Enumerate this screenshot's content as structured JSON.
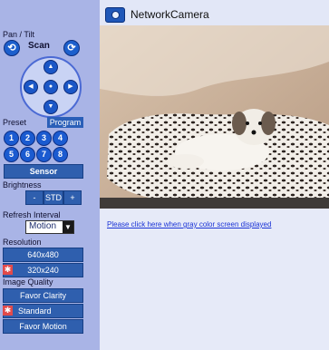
{
  "header": {
    "title": "NetworkCamera"
  },
  "sidebar": {
    "pan_tilt_label": "Pan / Tilt",
    "scan_label": "Scan",
    "preset_label": "Preset",
    "program_label": "Program",
    "presets": [
      "1",
      "2",
      "3",
      "4",
      "5",
      "6",
      "7",
      "8"
    ],
    "sensor_label": "Sensor",
    "brightness_label": "Brightness",
    "brightness_minus": "-",
    "brightness_std": "STD",
    "brightness_plus": "+",
    "refresh_label": "Refresh Interval",
    "refresh_value": "Motion",
    "resolution_label": "Resolution",
    "res_640": "640x480",
    "res_320": "320x240",
    "image_quality_label": "Image Quality",
    "favor_clarity": "Favor Clarity",
    "standard": "Standard",
    "favor_motion": "Favor Motion"
  },
  "main": {
    "gray_link": "Please click here when gray color screen displayed"
  },
  "colors": {
    "sidebar_bg": "#a9b4e6",
    "button_blue": "#2f5fae",
    "selected_marker": "#e24a4a",
    "link": "#1a33d6"
  }
}
